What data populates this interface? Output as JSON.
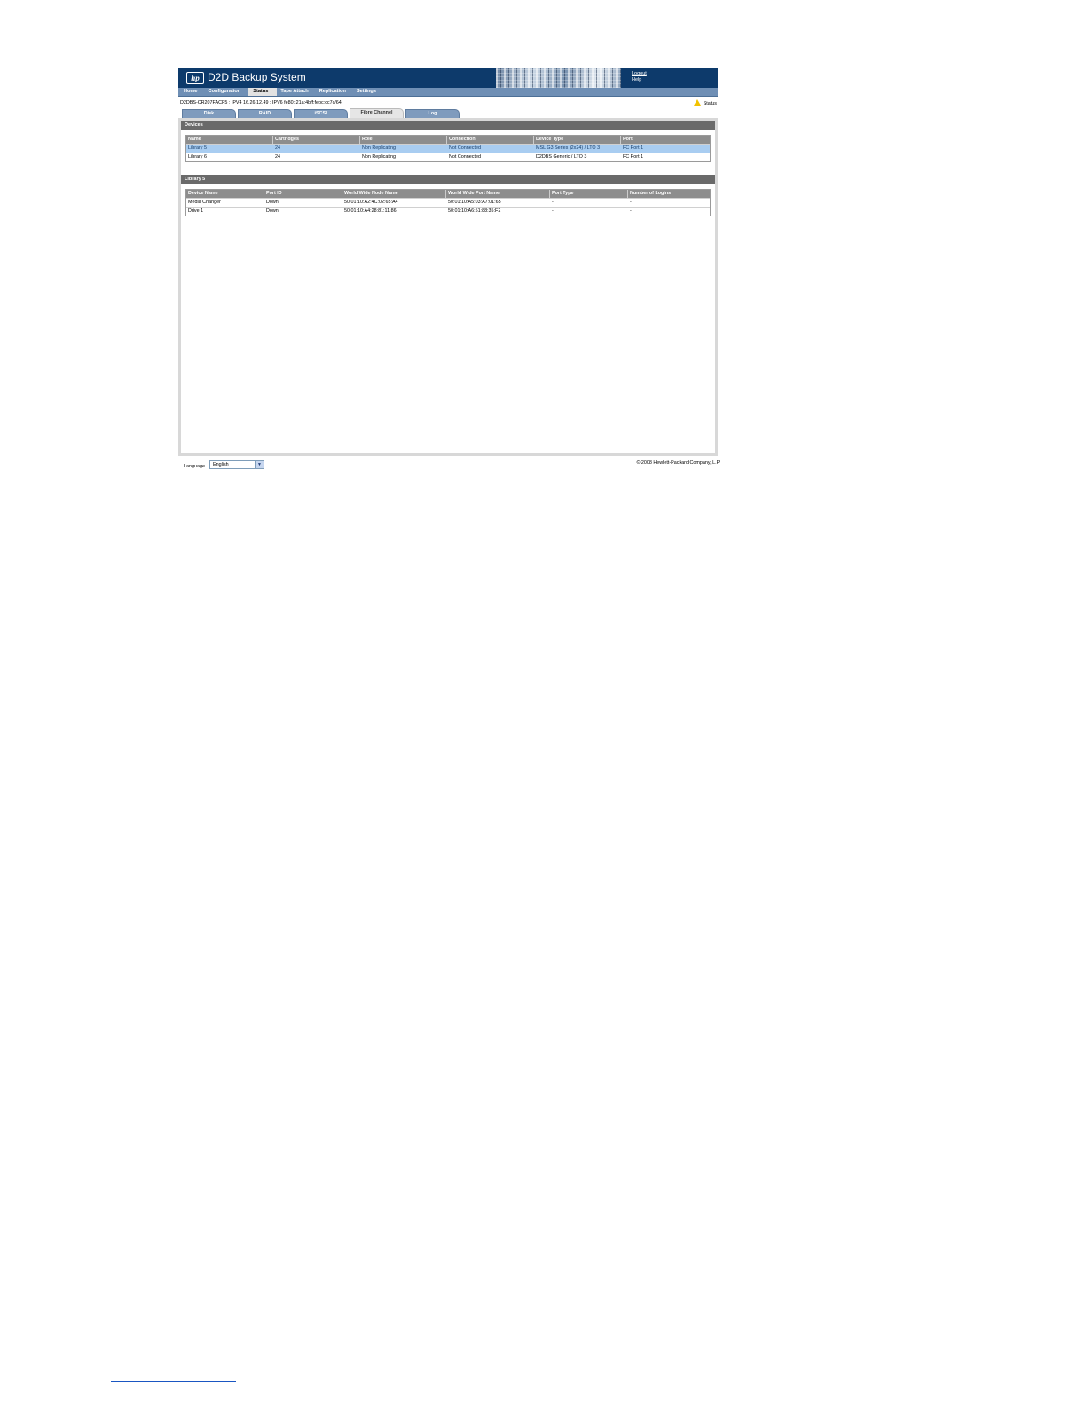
{
  "app": {
    "logo_text": "hp",
    "title": "D2D Backup System",
    "links": {
      "logout": "Logout",
      "help": "Help"
    }
  },
  "nav": [
    "Home",
    "Configuration",
    "Status",
    "Tape Attach",
    "Replication",
    "Settings"
  ],
  "nav_active": "Status",
  "info": {
    "host": "D2DBS-CR207FACF5 : IPV4 16.26.12.49 : IPV6 fe80::21a:4bff:febc:cc7c/64",
    "status_label": "Status"
  },
  "tabs": [
    "Disk",
    "RAID",
    "iSCSI",
    "Fibre Channel",
    "Log"
  ],
  "tabs_active": "Fibre Channel",
  "devices": {
    "title": "Devices",
    "columns": [
      "Name",
      "Cartridges",
      "Role",
      "Connection",
      "Device Type",
      "Port"
    ],
    "rows": [
      [
        "Library 5",
        "24",
        "Non Replicating",
        "Not Connected",
        "MSL G3 Series (2x24) / LTO 3",
        "FC Port 1"
      ],
      [
        "Library 6",
        "24",
        "Non Replicating",
        "Not Connected",
        "D2DBS Generic / LTO 3",
        "FC Port 1"
      ]
    ],
    "selected_row": 0
  },
  "library": {
    "title": "Library 5",
    "columns": [
      "Device Name",
      "Port ID",
      "World Wide Node Name",
      "World Wide Port Name",
      "Port Type",
      "Number of Logins"
    ],
    "rows": [
      [
        "Media Changer",
        "Down",
        "50:01:10:A2:4C:02:65:A4",
        "50:01:10:A5:03:A7:01:65",
        "-",
        "-"
      ],
      [
        "Drive 1",
        "Down",
        "50:01:10:A4:28:81:11:86",
        "50:01:10:A6:51:88:35:F2",
        "-",
        "-"
      ]
    ]
  },
  "footer": {
    "language_label": "Language",
    "language_value": "English",
    "copyright": "© 2008 Hewlett-Packard Company, L.P."
  },
  "colors": {
    "header": "#0d3a6b",
    "nav": "#6f8fb5",
    "tab": "#7f9bbd",
    "section_header": "#6a6a6a",
    "selected_row": "#a9cdf1"
  }
}
